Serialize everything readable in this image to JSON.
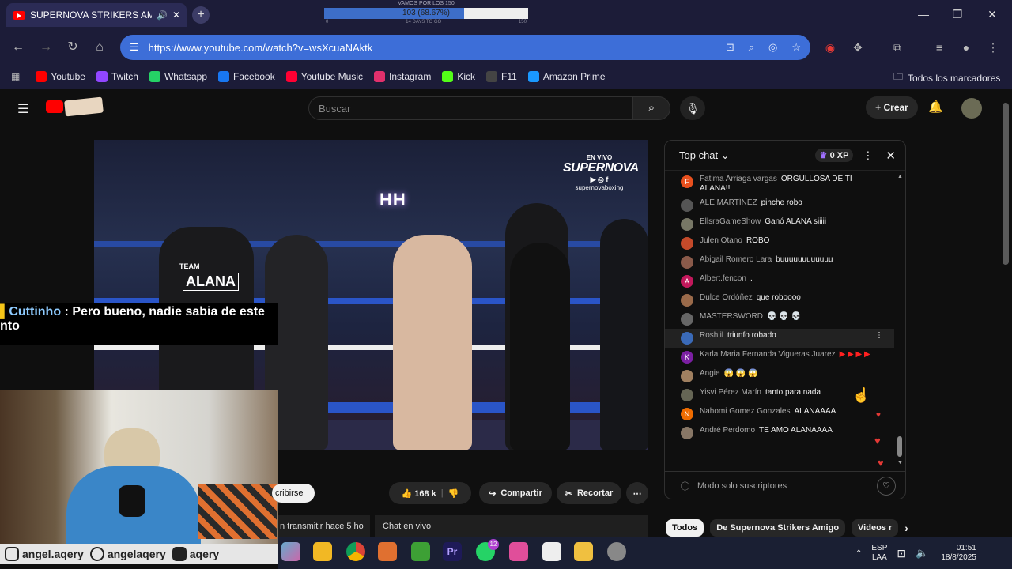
{
  "browser": {
    "tab_title": "SUPERNOVA STRIKERS AMIG",
    "url": "https://www.youtube.com/watch?v=wsXcuaNAktk",
    "progress": {
      "label": "VAMOS POR LOS 150",
      "text": "103 (68.67%)",
      "fraction": 0.6867,
      "min": "0",
      "sub": "14 DAYS TO GO",
      "max": "150"
    },
    "bookmarks": [
      {
        "label": "Youtube",
        "color": "#ff0000"
      },
      {
        "label": "Twitch",
        "color": "#9146ff"
      },
      {
        "label": "Whatsapp",
        "color": "#25d366"
      },
      {
        "label": "Facebook",
        "color": "#1877f2"
      },
      {
        "label": "Youtube Music",
        "color": "#ff0033"
      },
      {
        "label": "Instagram",
        "color": "#e1306c"
      },
      {
        "label": "Kick",
        "color": "#53fc18"
      },
      {
        "label": "F11",
        "color": "#444444"
      },
      {
        "label": "Amazon Prime",
        "color": "#1a98ff"
      }
    ],
    "all_bookmarks": "Todos los marcadores"
  },
  "youtube": {
    "search_placeholder": "Buscar",
    "create_label": "Crear"
  },
  "video": {
    "envivo": "EN VIVO",
    "brand": "SUPERNOVA",
    "handle": "supernovaboxing",
    "hh": "HH",
    "corner_tag": "TEAM",
    "corner_name": "ALANA"
  },
  "overlay": {
    "user": "Cuttinho",
    "line1": " : Pero bueno, nadie sabia de este",
    "line2": "nto"
  },
  "socials": [
    {
      "label": "angel.aqery"
    },
    {
      "label": "angelaqery"
    },
    {
      "label": "aqery"
    }
  ],
  "actions": {
    "subscribe": "cribirse",
    "likes": "168 k",
    "share": "Compartir",
    "clip": "Recortar"
  },
  "below": {
    "stream_info": "n transmitir hace 5 ho",
    "chat_replay": "Chat en vivo"
  },
  "chat": {
    "mode": "Top chat",
    "xp": "0 XP",
    "footer": "Modo solo suscriptores",
    "messages": [
      {
        "author": "Fatima Arriaga vargas",
        "text": "ORGULLOSA DE TI ALANA!!",
        "avatar": "F",
        "color": "#e8501e"
      },
      {
        "author": "ALE MARTÍNEZ",
        "text": "pinche robo",
        "avatar": "",
        "color": "#555555"
      },
      {
        "author": "EllsraGameShow",
        "text": "Ganó ALANA siiiii",
        "avatar": "",
        "color": "#777766"
      },
      {
        "author": "Julen Otano",
        "text": "ROBO",
        "avatar": "",
        "color": "#c44a2a"
      },
      {
        "author": "Abigail Romero Lara",
        "text": "buuuuuuuuuuuu",
        "avatar": "",
        "color": "#8a5a4a"
      },
      {
        "author": "Albert.fencon",
        "text": ".",
        "avatar": "A",
        "color": "#c2185b"
      },
      {
        "author": "Dulce Ordóñez",
        "text": "que roboooo",
        "avatar": "",
        "color": "#9a6a4a"
      },
      {
        "author": "MASTERSWORD",
        "text": "💀 💀 💀",
        "avatar": "",
        "color": "#666666"
      },
      {
        "author": "Roshiil",
        "text": "triunfo robado",
        "avatar": "",
        "color": "#3a6ab8"
      },
      {
        "author": "Karla Maria Fernanda Vigueras Juarez",
        "text": "▶ ▶ ▶ ▶",
        "avatar": "K",
        "color": "#7b1fa2"
      },
      {
        "author": "Angie",
        "text": "😱 😱 😱",
        "avatar": "",
        "color": "#a08060"
      },
      {
        "author": "Yisvi Pérez Marín",
        "text": "tanto para nada",
        "avatar": "",
        "color": "#666655"
      },
      {
        "author": "Nahomi Gomez Gonzales",
        "text": "ALANAAAA",
        "avatar": "N",
        "color": "#ef6c00"
      },
      {
        "author": "André Perdomo",
        "text": "TE AMO ALANAAAA",
        "avatar": "",
        "color": "#887766"
      }
    ]
  },
  "chips": [
    {
      "label": "Todos"
    },
    {
      "label": "De Supernova Strikers Amigo"
    },
    {
      "label": "Videos r"
    }
  ],
  "taskbar": {
    "lang": "ESP",
    "region": "LAA",
    "time": "01:51",
    "date": "18/8/2025",
    "badge": "12"
  }
}
